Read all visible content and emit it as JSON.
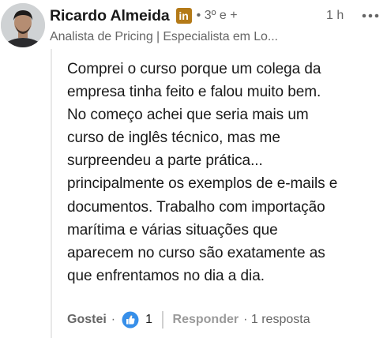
{
  "author": {
    "name": "Ricardo Almeida",
    "badge": "in",
    "degree": "• 3º e +",
    "headline": "Analista de Pricing | Especialista em Lo..."
  },
  "meta": {
    "time": "1 h"
  },
  "comment": {
    "lines": [
      "Comprei o curso porque um colega da",
      "empresa tinha feito e falou muito bem.",
      "No começo achei que seria mais um",
      "curso de inglês técnico, mas me",
      "surpreendeu a parte prática...",
      "principalmente os exemplos de e-mails e",
      "documentos. Trabalho com importação",
      "marítima e várias situações que",
      "aparecem no curso são exatamente as",
      "que enfrentamos no dia a dia."
    ]
  },
  "actions": {
    "like_label": "Gostei",
    "dot": "·",
    "reaction_count": "1",
    "reply_label": "Responder",
    "replies": "· 1 resposta"
  },
  "icons": {
    "more": "more-horizontal-icon",
    "reaction": "like-reaction-icon"
  },
  "colors": {
    "badge": "#b47a18",
    "like_blue": "#378fe9",
    "text_primary": "#191919",
    "text_secondary": "#666666"
  }
}
